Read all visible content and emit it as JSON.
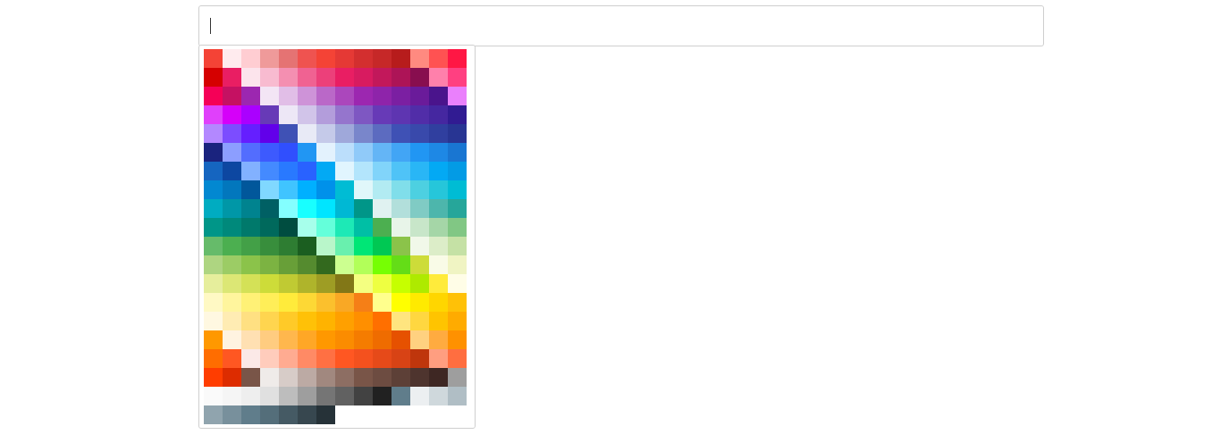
{
  "color_input": {
    "value": "",
    "placeholder": ""
  },
  "palette": {
    "swatches": [
      "#f44336",
      "#ffebee",
      "#ffcdd2",
      "#ef9a9a",
      "#e57373",
      "#ef5350",
      "#f44336",
      "#e53935",
      "#d32f2f",
      "#c62828",
      "#b71c1c",
      "#ff8a80",
      "#ff5252",
      "#ff1744",
      "#d50000",
      "#e91e63",
      "#fce4ec",
      "#f8bbd0",
      "#f48fb1",
      "#f06292",
      "#ec407a",
      "#e91e63",
      "#d81b60",
      "#c2185b",
      "#ad1457",
      "#880e4f",
      "#ff80ab",
      "#ff4081",
      "#f50057",
      "#c51162",
      "#9c27b0",
      "#f3e5f5",
      "#e1bee7",
      "#ce93d8",
      "#ba68c8",
      "#ab47bc",
      "#9c27b0",
      "#8e24aa",
      "#7b1fa2",
      "#6a1b9a",
      "#4a148c",
      "#ea80fc",
      "#e040fb",
      "#d500f9",
      "#aa00ff",
      "#673ab7",
      "#ede7f6",
      "#d1c4e9",
      "#b39ddb",
      "#9575cd",
      "#7e57c2",
      "#673ab7",
      "#5e35b1",
      "#512da8",
      "#4527a0",
      "#311b92",
      "#b388ff",
      "#7c4dff",
      "#651fff",
      "#6200ea",
      "#3f51b5",
      "#e8eaf6",
      "#c5cae9",
      "#9fa8da",
      "#7986cb",
      "#5c6bc0",
      "#3f51b5",
      "#3949ab",
      "#303f9f",
      "#283593",
      "#1a237e",
      "#8c9eff",
      "#536dfe",
      "#3d5afe",
      "#304ffe",
      "#2196f3",
      "#e3f2fd",
      "#bbdefb",
      "#90caf9",
      "#64b5f6",
      "#42a5f5",
      "#2196f3",
      "#1e88e5",
      "#1976d2",
      "#1565c0",
      "#0d47a1",
      "#82b1ff",
      "#448aff",
      "#2979ff",
      "#2962ff",
      "#03a9f4",
      "#e1f5fe",
      "#b3e5fc",
      "#81d4fa",
      "#4fc3f7",
      "#29b6f6",
      "#03a9f4",
      "#039be5",
      "#0288d1",
      "#0277bd",
      "#01579b",
      "#80d8ff",
      "#40c4ff",
      "#00b0ff",
      "#0091ea",
      "#00bcd4",
      "#e0f7fa",
      "#b2ebf2",
      "#80deea",
      "#4dd0e1",
      "#26c6da",
      "#00bcd4",
      "#00acc1",
      "#0097a7",
      "#00838f",
      "#006064",
      "#84ffff",
      "#18ffff",
      "#00e5ff",
      "#00b8d4",
      "#009688",
      "#e0f2f1",
      "#b2dfdb",
      "#80cbc4",
      "#4db6ac",
      "#26a69a",
      "#009688",
      "#00897b",
      "#00796b",
      "#00695c",
      "#004d40",
      "#a7ffeb",
      "#64ffda",
      "#1de9b6",
      "#00bfa5",
      "#4caf50",
      "#e8f5e9",
      "#c8e6c9",
      "#a5d6a7",
      "#81c784",
      "#66bb6a",
      "#4caf50",
      "#43a047",
      "#388e3c",
      "#2e7d32",
      "#1b5e20",
      "#b9f6ca",
      "#69f0ae",
      "#00e676",
      "#00c853",
      "#8bc34a",
      "#f1f8e9",
      "#dcedc8",
      "#c5e1a5",
      "#aed581",
      "#9ccc65",
      "#8bc34a",
      "#7cb342",
      "#689f38",
      "#558b2f",
      "#33691e",
      "#ccff90",
      "#b2ff59",
      "#76ff03",
      "#64dd17",
      "#cddc39",
      "#f9fbe7",
      "#f0f4c3",
      "#e6ee9c",
      "#dce775",
      "#d4e157",
      "#cddc39",
      "#c0ca33",
      "#afb42b",
      "#9e9d24",
      "#827717",
      "#f4ff81",
      "#eeff41",
      "#c6ff00",
      "#aeea00",
      "#ffeb3b",
      "#fffde7",
      "#fff9c4",
      "#fff59d",
      "#fff176",
      "#ffee58",
      "#ffeb3b",
      "#fdd835",
      "#fbc02d",
      "#f9a825",
      "#f57f17",
      "#ffff8d",
      "#ffff00",
      "#ffea00",
      "#ffd600",
      "#ffc107",
      "#fff8e1",
      "#ffecb3",
      "#ffe082",
      "#ffd54f",
      "#ffca28",
      "#ffc107",
      "#ffb300",
      "#ffa000",
      "#ff8f00",
      "#ff6f00",
      "#ffe57f",
      "#ffd740",
      "#ffc400",
      "#ffab00",
      "#ff9800",
      "#fff3e0",
      "#ffe0b2",
      "#ffcc80",
      "#ffb74d",
      "#ffa726",
      "#ff9800",
      "#fb8c00",
      "#f57c00",
      "#ef6c00",
      "#e65100",
      "#ffd180",
      "#ffab40",
      "#ff9100",
      "#ff6d00",
      "#ff5722",
      "#fbe9e7",
      "#ffccbc",
      "#ffab91",
      "#ff8a65",
      "#ff7043",
      "#ff5722",
      "#f4511e",
      "#e64a19",
      "#d84315",
      "#bf360c",
      "#ff9e80",
      "#ff6e40",
      "#ff3d00",
      "#dd2c00",
      "#795548",
      "#efebe9",
      "#d7ccc8",
      "#bcaaa4",
      "#a1887f",
      "#8d6e63",
      "#795548",
      "#6d4c41",
      "#5d4037",
      "#4e342e",
      "#3e2723",
      "#9e9e9e",
      "#fafafa",
      "#f5f5f5",
      "#eeeeee",
      "#e0e0e0",
      "#bdbdbd",
      "#9e9e9e",
      "#757575",
      "#616161",
      "#424242",
      "#212121",
      "#607d8b",
      "#eceff1",
      "#cfd8dc",
      "#b0bec5",
      "#90a4ae",
      "#78909c",
      "#607d8b",
      "#546e7a",
      "#455a64",
      "#37474f",
      "#263238"
    ]
  }
}
